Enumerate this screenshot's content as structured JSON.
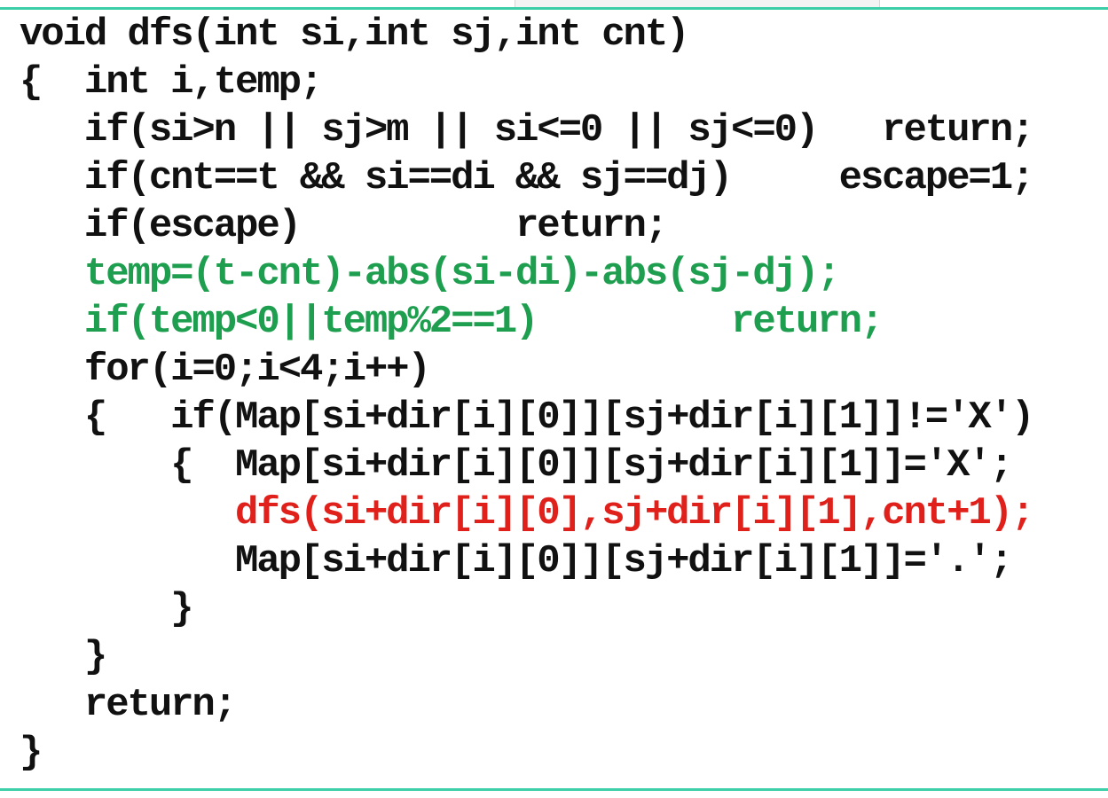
{
  "code": {
    "lines": [
      {
        "text": "void dfs(int si,int sj,int cnt)",
        "color": "plain"
      },
      {
        "text": "{  int i,temp;",
        "color": "plain"
      },
      {
        "text": "   if(si>n || sj>m || si<=0 || sj<=0)   return;",
        "color": "plain"
      },
      {
        "text": "   if(cnt==t && si==di && sj==dj)     escape=1;",
        "color": "plain"
      },
      {
        "text": "   if(escape)          return;",
        "color": "plain"
      },
      {
        "text": "   temp=(t-cnt)-abs(si-di)-abs(sj-dj);",
        "color": "green"
      },
      {
        "text": "   if(temp<0||temp%2==1)         return;",
        "color": "green"
      },
      {
        "text": "   for(i=0;i<4;i++)",
        "color": "plain"
      },
      {
        "text": "   {   if(Map[si+dir[i][0]][sj+dir[i][1]]!='X')",
        "color": "plain"
      },
      {
        "text": "       {  Map[si+dir[i][0]][sj+dir[i][1]]='X';",
        "color": "plain"
      },
      {
        "text": "          dfs(si+dir[i][0],sj+dir[i][1],cnt+1);",
        "color": "red"
      },
      {
        "text": "          Map[si+dir[i][0]][sj+dir[i][1]]='.';",
        "color": "plain"
      },
      {
        "text": "       }",
        "color": "plain"
      },
      {
        "text": "   }",
        "color": "plain"
      },
      {
        "text": "   return;",
        "color": "plain"
      },
      {
        "text": "}",
        "color": "plain"
      }
    ]
  },
  "colors": {
    "text": "#111111",
    "highlight_green": "#1e9e4f",
    "highlight_red": "#e0211b",
    "rule": "#3dcfa8",
    "background": "#ffffff"
  }
}
